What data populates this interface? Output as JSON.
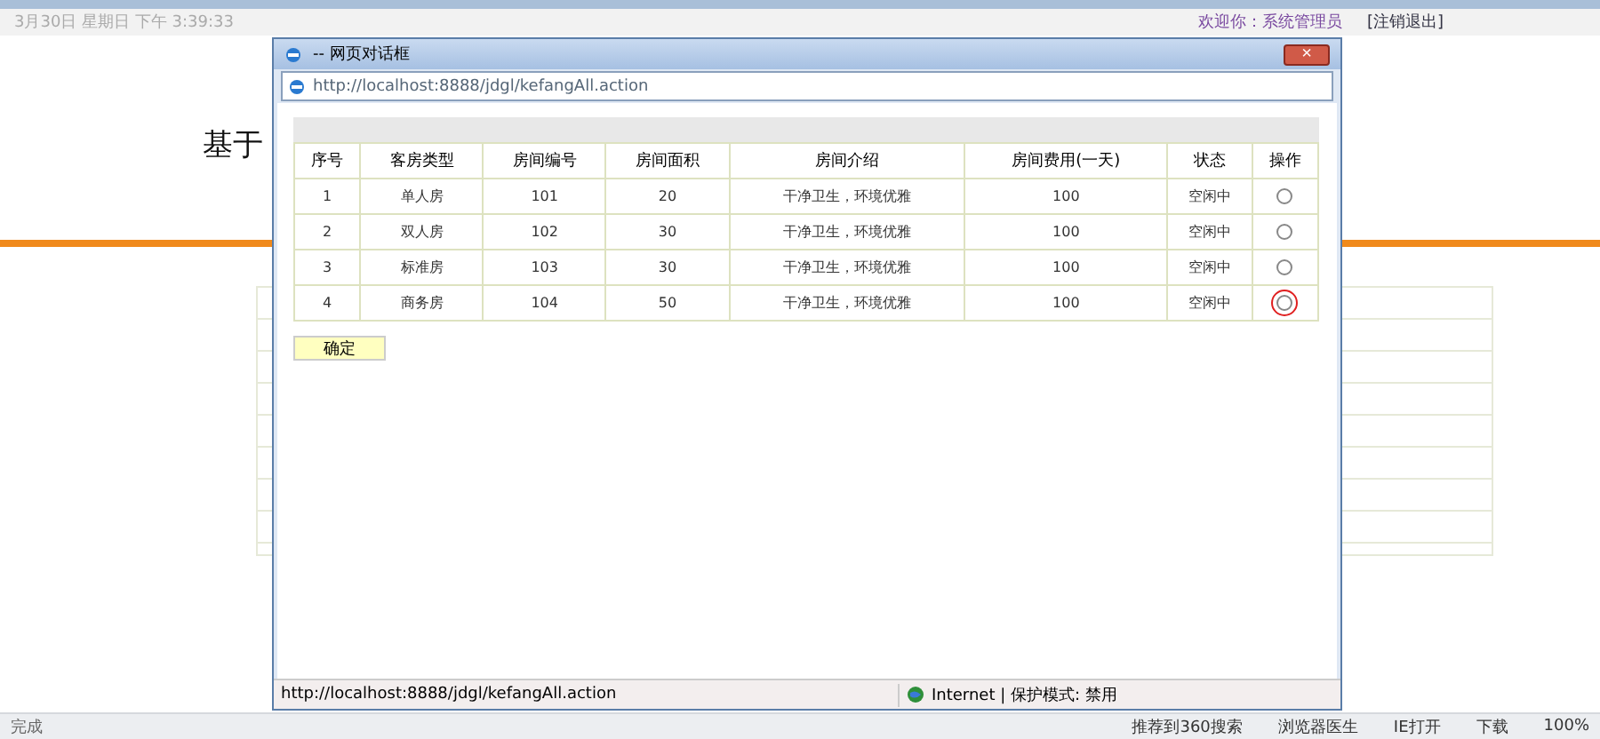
{
  "header": {
    "date": "3月30日 星期日 下午 3:39:33",
    "welcome": "欢迎你：系统管理员",
    "logout": "[注销退出]"
  },
  "page": {
    "title": "基于"
  },
  "dialog": {
    "title": "-- 网页对话框",
    "close": "×",
    "address": "http://localhost:8888/jdgl/kefangAll.action",
    "table": {
      "columns": [
        "序号",
        "客房类型",
        "房间编号",
        "房间面积",
        "房间介绍",
        "房间费用(一天)",
        "状态",
        "操作"
      ],
      "rows": [
        {
          "cells": [
            "1",
            "单人房",
            "101",
            "20",
            "干净卫生，环境优雅",
            "100",
            "空闲中"
          ],
          "selected": false,
          "highlighted": false
        },
        {
          "cells": [
            "2",
            "双人房",
            "102",
            "30",
            "干净卫生，环境优雅",
            "100",
            "空闲中"
          ],
          "selected": false,
          "highlighted": false
        },
        {
          "cells": [
            "3",
            "标准房",
            "103",
            "30",
            "干净卫生，环境优雅",
            "100",
            "空闲中"
          ],
          "selected": false,
          "highlighted": false
        },
        {
          "cells": [
            "4",
            "商务房",
            "104",
            "50",
            "干净卫生，环境优雅",
            "100",
            "空闲中"
          ],
          "selected": false,
          "highlighted": true
        }
      ]
    },
    "confirm": "确定",
    "status_url": "http://localhost:8888/jdgl/kefangAll.action",
    "zone": "Internet | 保护模式: 禁用"
  },
  "status_bar": {
    "state": "完成",
    "items": [
      "推荐到360搜索",
      "浏览器医生",
      "IE打开",
      "下载"
    ],
    "zoom": "100%"
  }
}
